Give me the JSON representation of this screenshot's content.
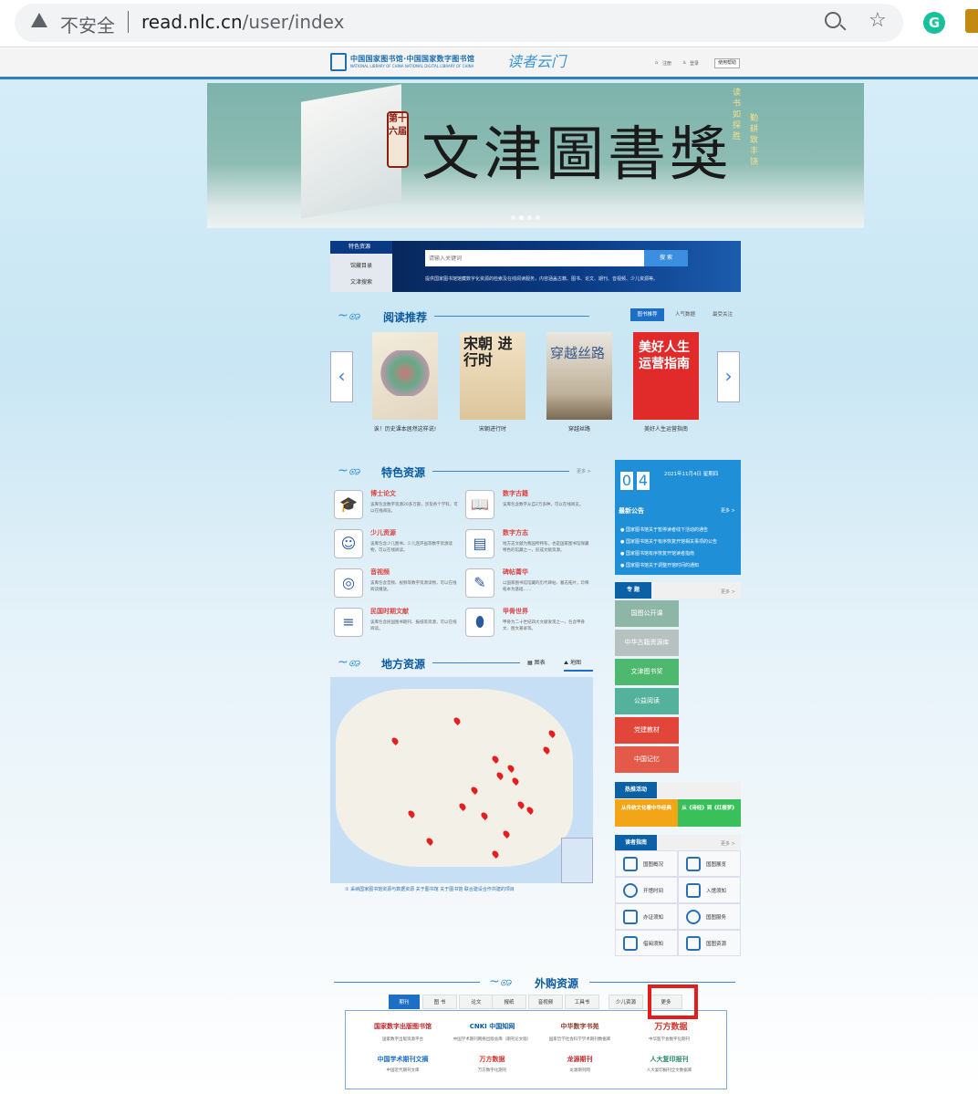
{
  "browser": {
    "security_label": "不安全",
    "url_host": "read.nlc.cn",
    "url_path": "/user/index",
    "ext_g": "G"
  },
  "header": {
    "logo_text": "中国国家图书馆·中国国家数字图书馆",
    "logo_sub": "NATIONAL LIBRARY OF CHINA    NATIONAL DIGITAL LIBRARY OF CHINA",
    "du_logo": "读者云门",
    "nav": [
      "注册",
      "登录"
    ],
    "help": "使用帮助"
  },
  "banner": {
    "seal": "第十六届",
    "title": "文津圖書獎",
    "right_line1": "读书如探胜",
    "right_line2": "勤耕致丰饶"
  },
  "search": {
    "tabs": [
      "特色资源",
      "馆藏目录",
      "文津搜索"
    ],
    "placeholder": "请输入关键词",
    "button": "搜 索",
    "note": "提供国家图书馆馆藏数字化资源的检索及在线阅读服务，内容涵盖古籍、图书、论文、期刊、音视频、少儿资源等。"
  },
  "reading": {
    "title": "阅读推荐",
    "tabs": [
      "图书推荐",
      "人气数据",
      "最受关注"
    ],
    "books": [
      {
        "caption": "诶！历史课本居然这样说!"
      },
      {
        "caption": "宋朝进行时"
      },
      {
        "caption": "穿越丝路"
      },
      {
        "caption": "美好人生运营指南"
      }
    ],
    "book_titles": [
      "",
      "宋朝 进行时",
      "穿越丝路",
      "美好人生运营指南"
    ]
  },
  "features": {
    "title": "特色资源",
    "more": "更多 >",
    "items": [
      {
        "title": "博士论文",
        "desc": "该库包含数字资源20多万部，涉及各个学科，可以在线阅览。"
      },
      {
        "title": "数字古籍",
        "desc": "该库包含数字从自2万多种，可以在线阅览。"
      },
      {
        "title": "少儿资源",
        "desc": "该库包含少儿图书、少儿连环画等数字资源读物，可以在线阅读。"
      },
      {
        "title": "数字方志",
        "desc": "地方志文献为我国所特有，也是国家图书馆保藏特色的馆藏之一，形成文献资源。"
      },
      {
        "title": "音视频",
        "desc": "该库包含音频、视频等数字资源读物，可以在线阅读播放。"
      },
      {
        "title": "碑帖菁华",
        "desc": "以国家图书馆馆藏的历代碑帖、墓志拓片，珍稀拓本为基础……"
      },
      {
        "title": "民国时期文献",
        "desc": "该库包含民国图书期刊、报纸等资源，可以在线阅读。"
      },
      {
        "title": "甲骨世界",
        "desc": "甲骨为二十世纪四大文献发现之一，包含甲骨文、图文著录等。"
      }
    ]
  },
  "date": {
    "day1": "0",
    "day2": "4",
    "text": "2021年11月4日  星期四"
  },
  "notices": {
    "title": "最新公告",
    "more": "更多 >",
    "items": [
      "国家图书馆关于暂停读者线下活动的通告",
      "国家图书馆关于有序恢复开馆相关事项的公告",
      "国家图书馆有序恢复开馆读者指南",
      "国家图书馆关于调整开馆时间的通知"
    ]
  },
  "special": {
    "tag": "专 题",
    "more": "更多 >",
    "items": [
      "国图公开课",
      "中华古籍资源库",
      "文津图书奖",
      "公益阅读",
      "党建教材",
      "中国记忆"
    ]
  },
  "hot": {
    "tag": "热推活动",
    "items": [
      "从传统文化看中华经典",
      "从《诗经》到《红楼梦》"
    ]
  },
  "guide": {
    "tag": "读者指南",
    "more": "更多 >",
    "items": [
      "国图概况",
      "国图展览",
      "开馆时间",
      "入馆须知",
      "办证须知",
      "国图服务",
      "借阅须知",
      "国图资源"
    ]
  },
  "local": {
    "title": "地方资源",
    "tabs": [
      "图表",
      "地图"
    ],
    "note": "① 采纳国家图书馆资源与数据资源 关于图书馆 关于图书馆 联合建设合作共建的项目"
  },
  "purchased": {
    "title": "外购资源",
    "tabs": [
      "期刊",
      "图 书",
      "论文",
      "报纸",
      "音视频",
      "工具书",
      "少儿资源",
      "更多"
    ],
    "db": [
      {
        "logo": "国家数字出版图书馆",
        "cap": "国家数字出版资源平台"
      },
      {
        "logo": "CNKI 中国知网",
        "cap": "中国学术期刊网络出版总库（期刊论文版）"
      },
      {
        "logo": "中华数字书苑",
        "cap": "国家哲学社会科学学术期刊数据库"
      },
      {
        "logo": "万方数据",
        "cap": "中华医学会数字化期刊"
      },
      {
        "logo": "中国学术期刊文摘",
        "cap": "中国近代期刊文库"
      },
      {
        "logo": "万方数据",
        "cap": "万方数字化期刊"
      },
      {
        "logo": "龙源期刊",
        "cap": "龙源期刊网"
      },
      {
        "logo": "人大复印报刊",
        "cap": "人大复印报刊全文数据库"
      }
    ]
  },
  "colors": {
    "accent": "#1d6fc5",
    "highlight": "#e31c1c"
  }
}
